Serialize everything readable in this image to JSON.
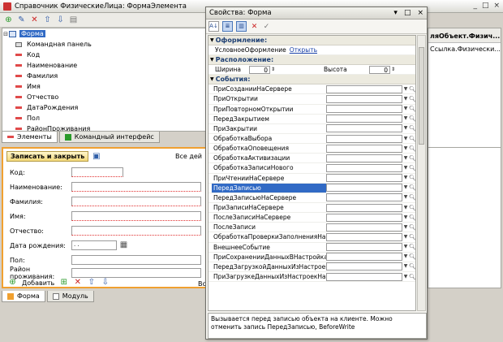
{
  "window": {
    "title": "Справочник ФизическиеЛица: ФормаЭлемента",
    "controls": [
      "_",
      "□",
      "×"
    ]
  },
  "toolbar": {
    "icons": [
      "add-icon",
      "edit-icon",
      "delete-icon",
      "move-up-icon",
      "move-down-icon",
      "filter-icon"
    ]
  },
  "tree": {
    "root": "Форма",
    "items": [
      "Командная панель",
      "Код",
      "Наименование",
      "Фамилия",
      "Имя",
      "Отчество",
      "ДатаРождения",
      "Пол",
      "РайонПроживания"
    ]
  },
  "tabs_top": [
    "Элементы",
    "Командный интерфейс"
  ],
  "right_header": {
    "title": "ляОбъект.Физич...",
    "cell": "Ссылка.Физически..."
  },
  "form_preview": {
    "save_close": "Записать и закрыть",
    "all_actions": "Все дей",
    "fields": [
      "Код:",
      "Наименование:",
      "Фамилия:",
      "Имя:",
      "Отчество:",
      "Дата рождения:",
      "Пол:",
      "Район проживания:"
    ],
    "date_value": " .  .    ",
    "bottom_add": "Добавить",
    "bottom_right": "Вс"
  },
  "bottom_tabs": [
    "Форма",
    "Модуль"
  ],
  "props": {
    "title": "Свойства: Форма",
    "controls": [
      "▾",
      "□",
      "×"
    ],
    "sections": {
      "design": "Оформление:",
      "layout": "Расположение:",
      "events": "События:"
    },
    "conditional_label": "УсловноеОформление",
    "conditional_link": "Открыть",
    "width_label": "Ширина",
    "width_value": "0",
    "height_label": "Высота",
    "height_value": "0",
    "events": [
      "ПриСозданииНаСервере",
      "ПриОткрытии",
      "ПриПовторномОткрытии",
      "ПередЗакрытием",
      "ПриЗакрытии",
      "ОбработкаВыбора",
      "ОбработкаОповещения",
      "ОбработкаАктивизации",
      "ОбработкаЗаписиНового",
      "ПриЧтенииНаСервере",
      "ПередЗаписью",
      "ПередЗаписьюНаСервере",
      "ПриЗаписиНаСервере",
      "ПослеЗаписиНаСервере",
      "ПослеЗаписи",
      "ОбработкаПроверкиЗаполненияНаСервере",
      "ВнешнееСобытие",
      "ПриСохраненииДанныхВНастройкахНаСервере",
      "ПередЗагрузкойДанныхИзНастроекНаСервере",
      "ПриЗагрузкеДанныхИзНастроекНаСервере"
    ],
    "selected_event": "ПередЗаписью",
    "description": "Вызывается перед записью объекта на клиенте. Можно отменить запись ПередЗаписью, BeforeWrite"
  }
}
